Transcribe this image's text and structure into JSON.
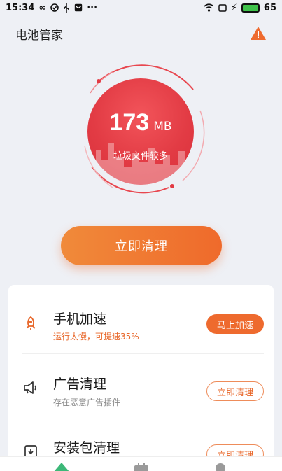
{
  "status_bar": {
    "time": "15:34",
    "battery": "65"
  },
  "header": {
    "title": "电池管家"
  },
  "junk": {
    "size": "173",
    "unit": "MB",
    "description": "垃圾文件较多"
  },
  "clean_button": {
    "label": "立即清理"
  },
  "items": [
    {
      "title": "手机加速",
      "subtitle": "运行太慢，可提速35%",
      "button": "马上加速",
      "icon": "rocket-icon"
    },
    {
      "title": "广告清理",
      "subtitle": "存在恶意广告插件",
      "button": "立即清理",
      "icon": "megaphone-icon"
    },
    {
      "title": "安装包清理",
      "subtitle": "",
      "button": "立即清理",
      "icon": "package-icon"
    }
  ],
  "colors": {
    "accent": "#ee6a2e",
    "circle": "#e23b44",
    "background": "#eef0f5"
  }
}
